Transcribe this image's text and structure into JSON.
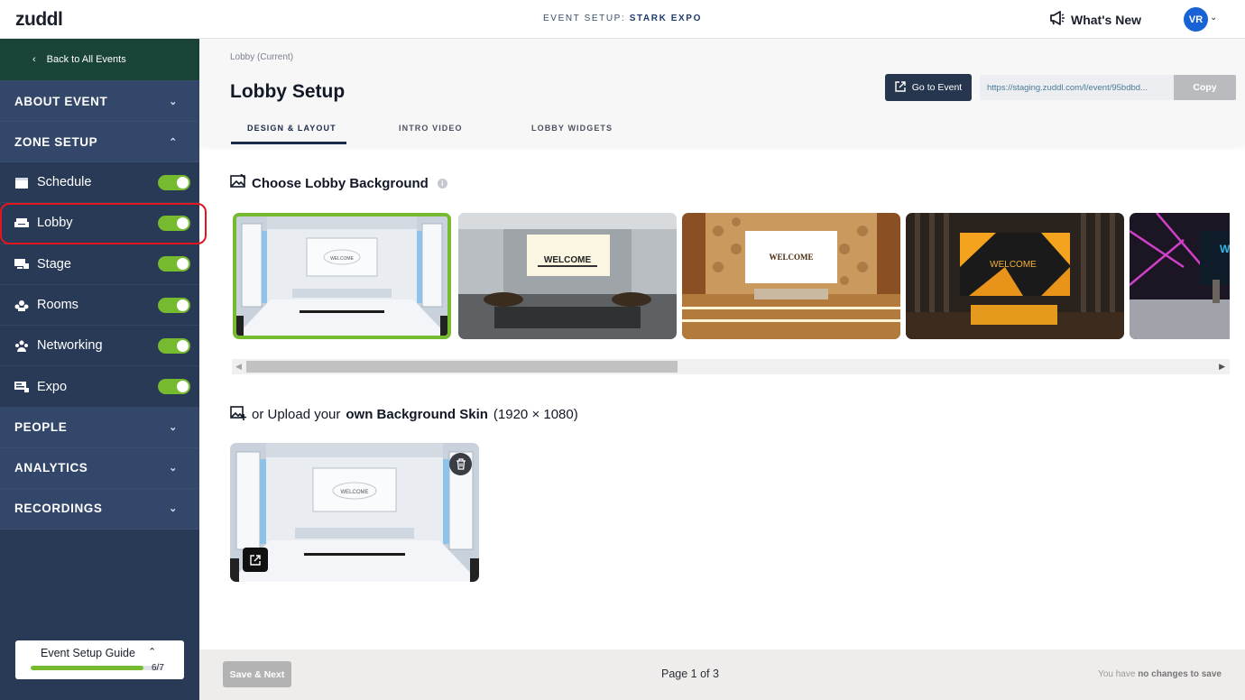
{
  "topbar": {
    "logo": "zuddl",
    "event_setup_label": "EVENT SETUP:",
    "event_name": "STARK EXPO",
    "whats_new": "What's New",
    "avatar_initials": "VR"
  },
  "sidebar": {
    "back_label": "Back to All Events",
    "sections": {
      "about_event": "ABOUT EVENT",
      "zone_setup": "ZONE SETUP",
      "people": "PEOPLE",
      "analytics": "ANALYTICS",
      "recordings": "RECORDINGS"
    },
    "zones": [
      {
        "label": "Schedule",
        "icon": "calendar-icon",
        "enabled": true
      },
      {
        "label": "Lobby",
        "icon": "sofa-icon",
        "enabled": true
      },
      {
        "label": "Stage",
        "icon": "stage-icon",
        "enabled": true
      },
      {
        "label": "Rooms",
        "icon": "rooms-icon",
        "enabled": true
      },
      {
        "label": "Networking",
        "icon": "people-icon",
        "enabled": true
      },
      {
        "label": "Expo",
        "icon": "booth-icon",
        "enabled": true
      }
    ],
    "guide": {
      "title": "Event Setup Guide",
      "progress": "6/7",
      "progress_fraction": 0.857
    }
  },
  "header": {
    "breadcrumb": "Lobby (Current)",
    "title": "Lobby Setup",
    "go_to_event": "Go to Event",
    "url": "https://staging.zuddl.com/l/event/95bdbd...",
    "copy": "Copy",
    "tabs": [
      "DESIGN & LAYOUT",
      "INTRO VIDEO",
      "LOBBY WIDGETS"
    ],
    "active_tab": "DESIGN & LAYOUT"
  },
  "backgrounds": {
    "heading": "Choose Lobby Background",
    "thumb_texts": [
      "WELCOME",
      "WELCOME",
      "WELCOME",
      "WELCOME",
      "WE"
    ],
    "selected_index": 0
  },
  "upload": {
    "prefix": "or Upload your",
    "bold": "own Background Skin",
    "suffix": "(1920 × 1080)",
    "thumb_text": "WELCOME"
  },
  "footer": {
    "save_next": "Save & Next",
    "page": "Page 1 of 3",
    "status_prefix": "You have",
    "status_bold": "no changes to save"
  },
  "colors": {
    "sidebar": "#293a56",
    "toggle_on": "#76bb2f",
    "highlight": "#e3161f"
  }
}
